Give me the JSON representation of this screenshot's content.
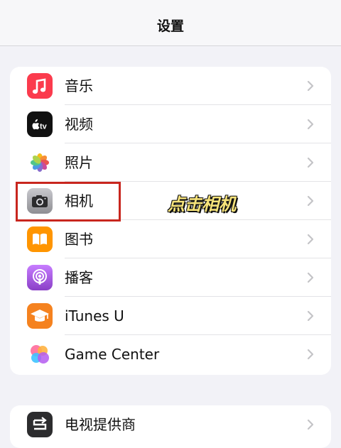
{
  "nav": {
    "title": "设置"
  },
  "group1": [
    {
      "label": "音乐",
      "icon": "music-note-icon",
      "color": "#fb3b4d"
    },
    {
      "label": "视频",
      "icon": "apple-tv-icon",
      "color": "#111111"
    },
    {
      "label": "照片",
      "icon": "photos-flower-icon",
      "color": "#ffffff"
    },
    {
      "label": "相机",
      "icon": "camera-icon",
      "color": "#8e8e93"
    },
    {
      "label": "图书",
      "icon": "book-icon",
      "color": "#ff9500"
    },
    {
      "label": "播客",
      "icon": "podcast-icon",
      "color": "#a25ad9"
    },
    {
      "label": "iTunes U",
      "icon": "graduation-cap-icon",
      "color": "#f5821f"
    },
    {
      "label": "Game Center",
      "icon": "game-center-icon",
      "color": "#ffffff"
    }
  ],
  "group2": [
    {
      "label": "电视提供商",
      "icon": "tv-provider-icon",
      "color": "#2c2c2e"
    }
  ],
  "apple_tv_text": "tv",
  "annotation": {
    "text": "点击相机",
    "color": "#f6e37a"
  },
  "highlight_color": "#c8261e"
}
